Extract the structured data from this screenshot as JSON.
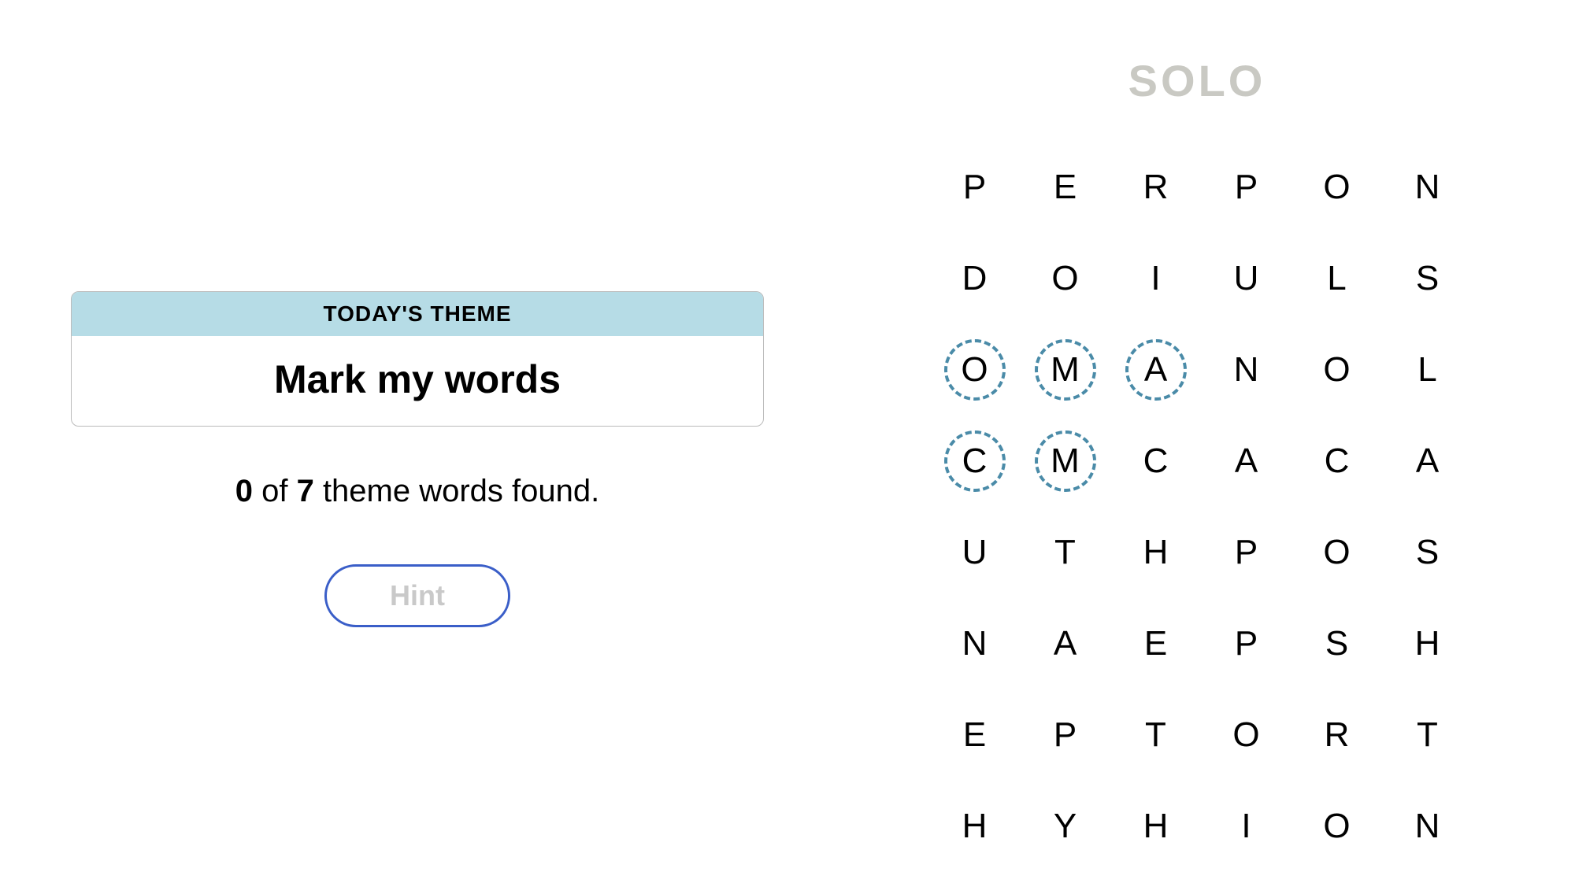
{
  "theme": {
    "header_label": "TODAY'S THEME",
    "title": "Mark my words"
  },
  "progress": {
    "found_count": "0",
    "of_label": " of ",
    "total_count": "7",
    "suffix": " theme words found."
  },
  "hint": {
    "label": "Hint"
  },
  "found_word_display": "SOLO",
  "grid": {
    "rows": [
      [
        "P",
        "E",
        "R",
        "P",
        "O",
        "N"
      ],
      [
        "D",
        "O",
        "I",
        "U",
        "L",
        "S"
      ],
      [
        "O",
        "M",
        "A",
        "N",
        "O",
        "L"
      ],
      [
        "C",
        "M",
        "C",
        "A",
        "C",
        "A"
      ],
      [
        "U",
        "T",
        "H",
        "P",
        "O",
        "S"
      ],
      [
        "N",
        "A",
        "E",
        "P",
        "S",
        "H"
      ],
      [
        "E",
        "P",
        "T",
        "O",
        "R",
        "T"
      ],
      [
        "H",
        "Y",
        "H",
        "I",
        "O",
        "N"
      ]
    ],
    "highlighted": [
      [
        2,
        0
      ],
      [
        2,
        1
      ],
      [
        2,
        2
      ],
      [
        3,
        0
      ],
      [
        3,
        1
      ]
    ]
  }
}
